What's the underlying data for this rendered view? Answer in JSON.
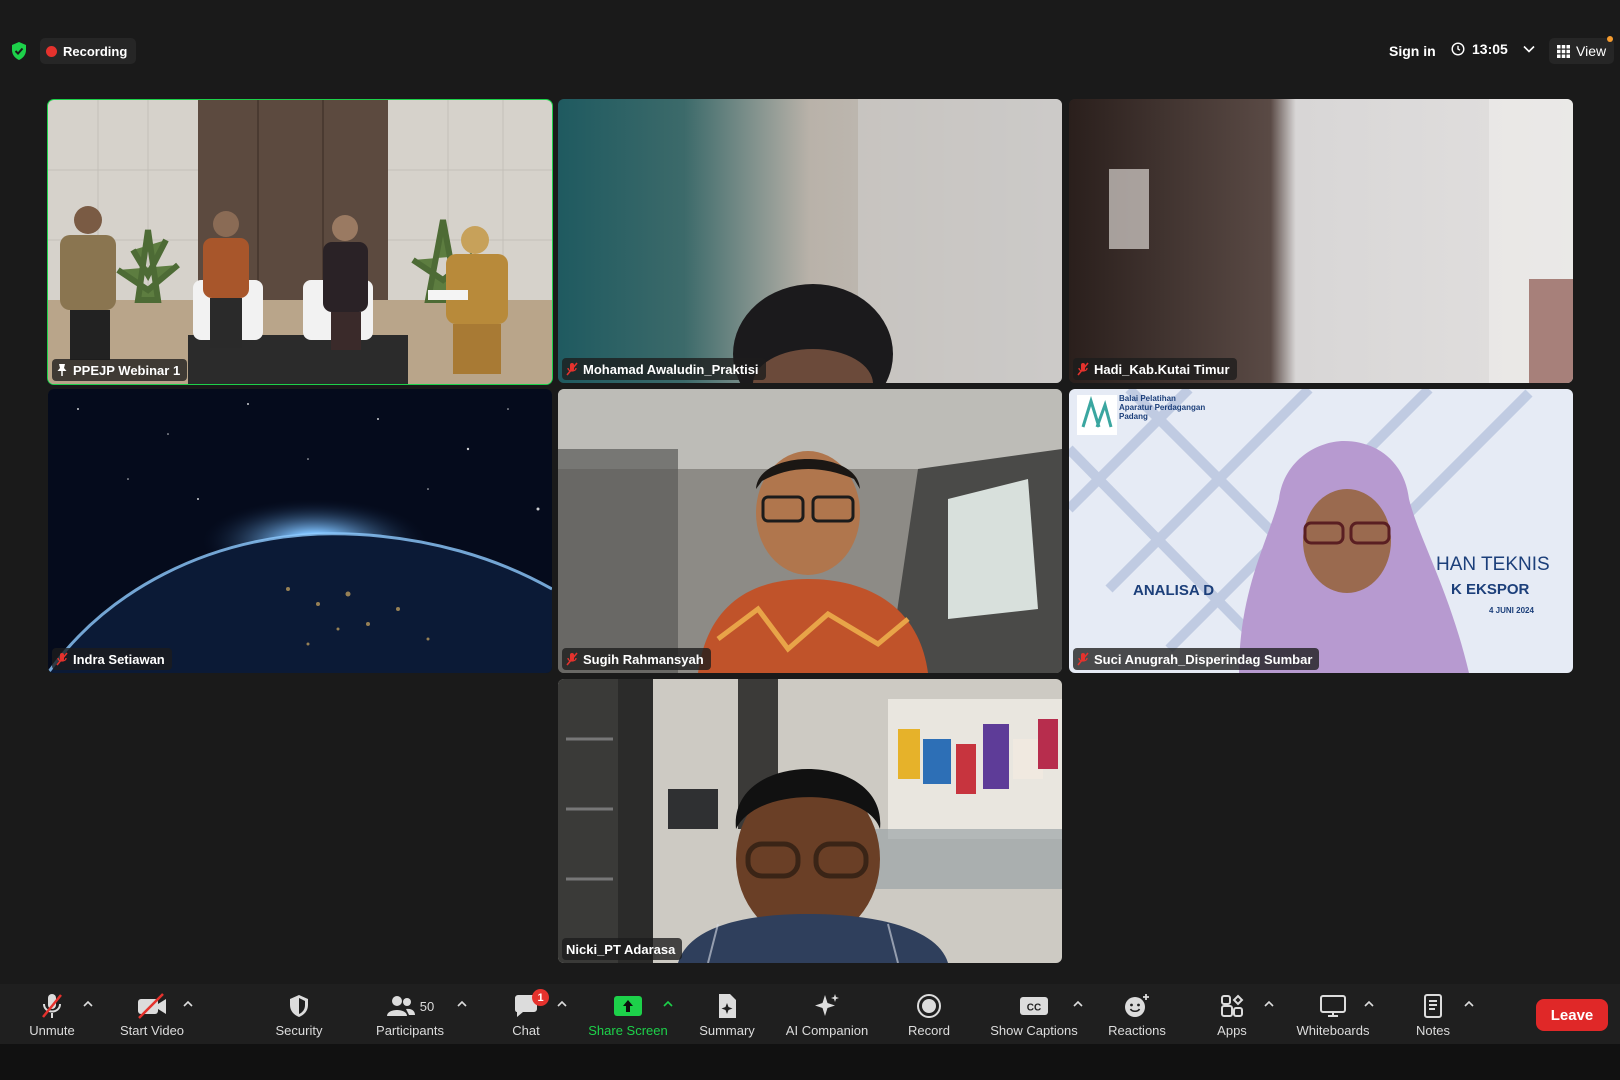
{
  "topbar": {
    "recording_label": "Recording",
    "sign_in_label": "Sign in",
    "clock_time": "13:05",
    "view_label": "View"
  },
  "tiles": [
    {
      "name": "PPEJP Webinar 1",
      "status_icon": "pin-icon",
      "active": true
    },
    {
      "name": "Mohamad Awaludin_Praktisi",
      "status_icon": "muted-mic-icon"
    },
    {
      "name": "Hadi_Kab.Kutai Timur",
      "status_icon": "muted-mic-icon"
    },
    {
      "name": "Indra Setiawan",
      "status_icon": "muted-mic-icon"
    },
    {
      "name": "Sugih Rahmansyah",
      "status_icon": "muted-mic-icon"
    },
    {
      "name": "Suci Anugrah_Disperindag Sumbar",
      "status_icon": "muted-mic-icon"
    },
    {
      "name": "Nicki_PT Adarasa",
      "status_icon": "none"
    }
  ],
  "slide": {
    "org_line1": "Balai Pelatihan",
    "org_line2": "Aparatur Perdagangan",
    "org_line3": "Padang",
    "text_left": "ANALISA D",
    "text_right_1": "HAN TEKNIS",
    "text_right_2": "K EKSPOR",
    "text_right_3": "4 JUNI 2024"
  },
  "toolbar": {
    "unmute": "Unmute",
    "start_video": "Start Video",
    "security": "Security",
    "participants": "Participants",
    "participants_count": "50",
    "chat": "Chat",
    "chat_badge": "1",
    "share_screen": "Share Screen",
    "summary": "Summary",
    "ai_companion": "AI Companion",
    "record": "Record",
    "show_captions": "Show Captions",
    "reactions": "Reactions",
    "apps": "Apps",
    "whiteboards": "Whiteboards",
    "notes": "Notes",
    "leave": "Leave"
  },
  "colors": {
    "active_speaker_border": "#1dd14a",
    "share_green": "#1dd14a",
    "leave_red": "#e02828",
    "recording_red": "#e5322d"
  }
}
